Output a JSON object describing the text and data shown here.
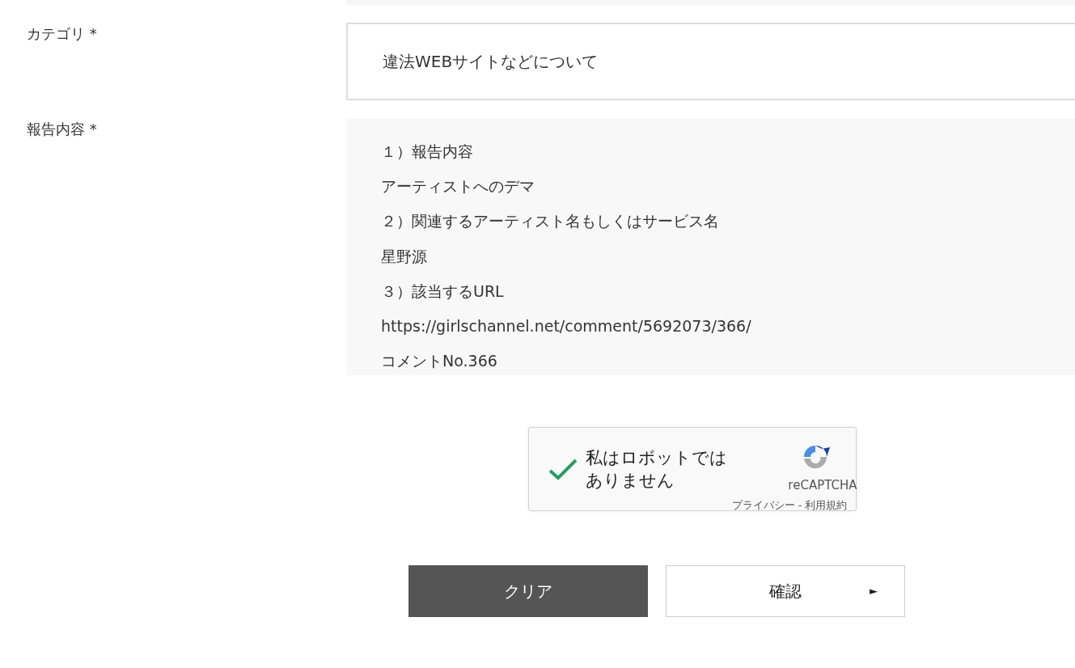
{
  "fields": [
    {
      "kind": "select",
      "label": "カテゴリ *",
      "value": "違法WEBサイトなどについて"
    },
    {
      "kind": "textarea",
      "label": "報告内容 *",
      "value_lines": [
        "１）報告内容",
        "アーティストへのデマ",
        "２）関連するアーティスト名もしくはサービス名",
        "星野源",
        "３）該当するURL",
        "https://girlschannel.net/comment/5692073/366/",
        "コメントNo.366"
      ]
    }
  ],
  "captcha": {
    "checked": true,
    "label_lines": [
      "私はロボットでは",
      "ありません"
    ],
    "brand": "reCAPTCHA",
    "links": "プライバシー - 利用規約"
  },
  "buttons": [
    {
      "kind": "clear",
      "label": "クリア"
    },
    {
      "kind": "confirm",
      "label": "確認",
      "arrow": "►"
    }
  ]
}
